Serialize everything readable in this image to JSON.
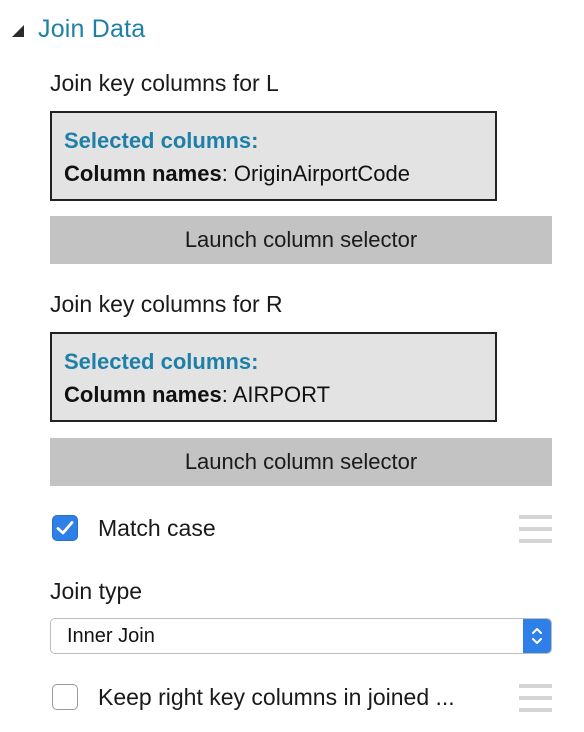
{
  "panel": {
    "title": "Join Data",
    "left": {
      "label": "Join key columns for L",
      "selected_heading": "Selected columns:",
      "column_names_key": "Column names",
      "column_names_value": ": OriginAirportCode",
      "launch_label": "Launch column selector"
    },
    "right": {
      "label": "Join key columns for R",
      "selected_heading": "Selected columns:",
      "column_names_key": "Column names",
      "column_names_value": ": AIRPORT",
      "launch_label": "Launch column selector"
    },
    "match_case": {
      "label": "Match case",
      "checked": true
    },
    "join_type": {
      "label": "Join type",
      "value": "Inner Join"
    },
    "keep_right": {
      "label": "Keep right key columns in joined ...",
      "checked": false
    }
  },
  "colors": {
    "accent": "#1e7fa8",
    "checkbox_blue": "#2f7fe8",
    "button_gray": "#c3c3c3",
    "box_gray": "#e3e3e3"
  },
  "icons": [
    "collapse-triangle-icon",
    "checkmark-icon",
    "drag-handle-icon",
    "select-arrows-icon"
  ]
}
